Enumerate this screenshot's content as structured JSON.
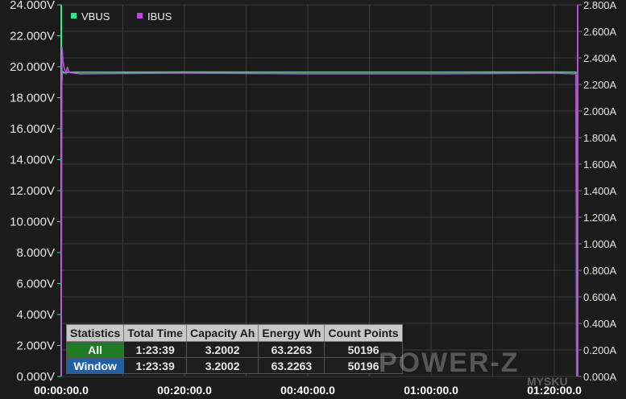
{
  "chart_data": {
    "type": "line",
    "x_ticks": [
      "00:00:00.0",
      "00:20:00.0",
      "00:40:00.0",
      "01:00:00.0",
      "01:20:00.0"
    ],
    "x_range_minutes": [
      0,
      83.65
    ],
    "y_left": {
      "ticks": [
        "0.000V",
        "2.000V",
        "4.000V",
        "6.000V",
        "8.000V",
        "10.000V",
        "12.000V",
        "14.000V",
        "16.000V",
        "18.000V",
        "20.000V",
        "22.000V",
        "24.000V"
      ],
      "range": [
        0,
        24
      ]
    },
    "y_right": {
      "ticks": [
        "0.000A",
        "0.200A",
        "0.400A",
        "0.600A",
        "0.800A",
        "1.000A",
        "1.200A",
        "1.400A",
        "1.600A",
        "1.800A",
        "2.000A",
        "2.200A",
        "2.400A",
        "2.600A",
        "2.800A"
      ],
      "range": [
        0,
        2.8
      ]
    },
    "legend": {
      "placement": "top-left"
    },
    "series": [
      {
        "name": "VBUS",
        "axis": "left",
        "color": "#2ee88a",
        "points": [
          [
            0,
            0
          ],
          [
            0.08,
            18.9
          ],
          [
            0.2,
            19.7
          ],
          [
            0.5,
            19.6
          ],
          [
            1.2,
            19.65
          ],
          [
            10,
            19.65
          ],
          [
            20,
            19.66
          ],
          [
            40,
            19.65
          ],
          [
            60,
            19.65
          ],
          [
            80,
            19.66
          ],
          [
            83.5,
            19.65
          ],
          [
            83.62,
            0
          ]
        ]
      },
      {
        "name": "IBUS",
        "axis": "right",
        "color": "#b84dd8",
        "points": [
          [
            0,
            0
          ],
          [
            0.05,
            1.7
          ],
          [
            0.14,
            2.48
          ],
          [
            0.28,
            2.38
          ],
          [
            0.5,
            2.32
          ],
          [
            0.8,
            2.28
          ],
          [
            1.0,
            2.33
          ],
          [
            1.3,
            2.29
          ],
          [
            3,
            2.28
          ],
          [
            20,
            2.285
          ],
          [
            40,
            2.28
          ],
          [
            60,
            2.28
          ],
          [
            80,
            2.285
          ],
          [
            83.5,
            2.28
          ],
          [
            83.62,
            0
          ]
        ]
      }
    ]
  },
  "stats": {
    "headers": [
      "Statistics",
      "Total Time",
      "Capacity Ah",
      "Energy Wh",
      "Count Points"
    ],
    "rows": [
      [
        "All",
        "1:23:39",
        "3.2002",
        "63.2263",
        "50196"
      ],
      [
        "Window",
        "1:23:39",
        "3.2002",
        "63.2263",
        "50196"
      ]
    ]
  },
  "watermark": {
    "logo_text": "POWER-Z",
    "site_text": "MYSKU"
  },
  "colors": {
    "background": "#1b1b1b",
    "grid": "#3a3a3a",
    "axis_left": "#2ee88a",
    "axis_right": "#b84dd8"
  }
}
